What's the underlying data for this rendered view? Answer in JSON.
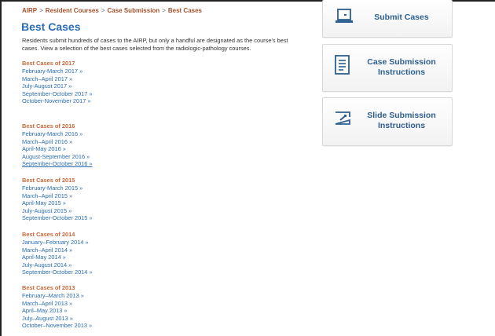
{
  "breadcrumb": {
    "items": [
      "AIRP",
      "Resident Courses",
      "Case Submission",
      "Best Cases"
    ],
    "separator": ">"
  },
  "page": {
    "title": "Best Cases",
    "intro": "Residents submit hundreds of cases to the AIRP, but only a handful are designated as the course's best cases. View a selection of the best cases selected from the radiologic-pathology courses."
  },
  "years": [
    {
      "title": "Best Cases of 2017",
      "links": [
        "February-March 2017 »",
        "March–April 2017 »",
        "July-August 2017 »",
        "September-October 2017 »",
        "October-November 2017 »"
      ]
    },
    {
      "title": "Best Cases of 2016",
      "links": [
        "February-March 2016 »",
        "March–April 2016 »",
        "April-May 2016 »",
        "August-September 2016 »",
        "September-October 2016 »"
      ]
    },
    {
      "title": "Best Cases of 2015",
      "links": [
        "February-March 2015 »",
        "March–April 2015 »",
        "April-May 2015 »",
        "July-August 2015 »",
        "September-October 2015 »"
      ]
    },
    {
      "title": "Best Cases of 2014",
      "links": [
        "January–February 2014 »",
        "March–April 2014 »",
        "April-May 2014 »",
        "July-August 2014 »",
        "September-October 2014 »"
      ]
    },
    {
      "title": "Best Cases of 2013",
      "links": [
        "February–March 2013 »",
        "March–April 2013 »",
        "April–May 2013 »",
        "July–August 2013 »",
        "October–November 2013 »"
      ]
    }
  ],
  "sidebar": {
    "submit_cases": "Submit Cases",
    "case_instructions": "Case Submission Instructions",
    "slide_instructions": "Slide Submission Instructions"
  },
  "icons": {
    "submit": "laptop-icon",
    "case": "document-icon",
    "slide": "slide-icon"
  },
  "colors": {
    "link": "#2a6db0",
    "year_heading": "#c8693a",
    "breadcrumb": "#a0522d",
    "card_text": "#2e5f8f"
  }
}
